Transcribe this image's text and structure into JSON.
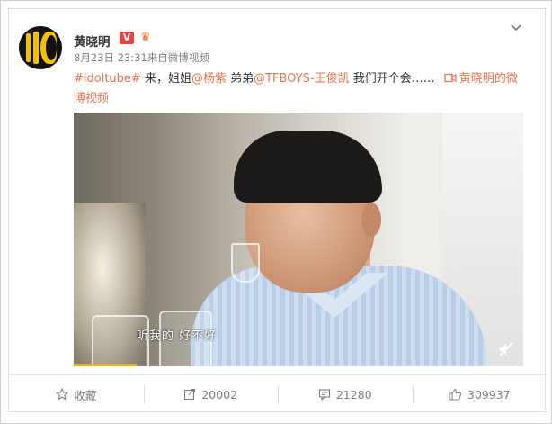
{
  "post": {
    "username": "黄晓明",
    "verified_badge": "V",
    "member_icon": "crown-icon",
    "meta": "8月23日 23:31来自微博视频",
    "hashtag": "#idoltube#",
    "text_part1": " 来，姐姐",
    "mention1": "@杨紫",
    "text_part2": " 弟弟",
    "mention2": "@TFBOYS-王俊凯",
    "text_part3": " 我们开个会…… ",
    "video_link": "黄晓明的微博视频"
  },
  "video": {
    "subtitle": "听我的 好不好",
    "progress_fraction": 0.14
  },
  "actions": {
    "favorite_label": "收藏",
    "repost_count": "20002",
    "comment_count": "21280",
    "like_count": "309937"
  },
  "colors": {
    "accent": "#eb7350",
    "verified": "#f0413c",
    "progress": "#f0b41e"
  }
}
